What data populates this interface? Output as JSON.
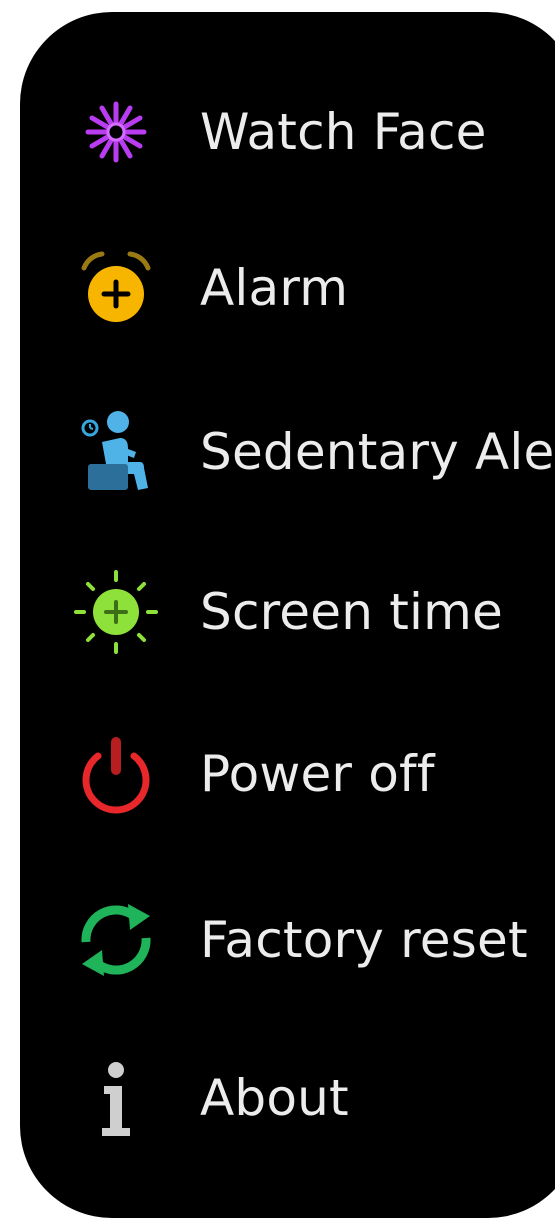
{
  "menu": {
    "items": [
      {
        "label": "Watch Face",
        "icon": "watch-face-icon",
        "color": "#b83cf0"
      },
      {
        "label": "Alarm",
        "icon": "alarm-clock-icon",
        "color": "#f7b500"
      },
      {
        "label": "Sedentary Alert",
        "icon": "sedentary-person-icon",
        "color": "#35a8e0"
      },
      {
        "label": "Screen time",
        "icon": "brightness-sun-icon",
        "color": "#8ee03a"
      },
      {
        "label": "Power off",
        "icon": "power-icon",
        "color": "#e8272a"
      },
      {
        "label": "Factory reset",
        "icon": "refresh-arrows-icon",
        "color": "#1fb45a"
      },
      {
        "label": "About",
        "icon": "info-icon",
        "color": "#cfcfcf"
      }
    ]
  }
}
